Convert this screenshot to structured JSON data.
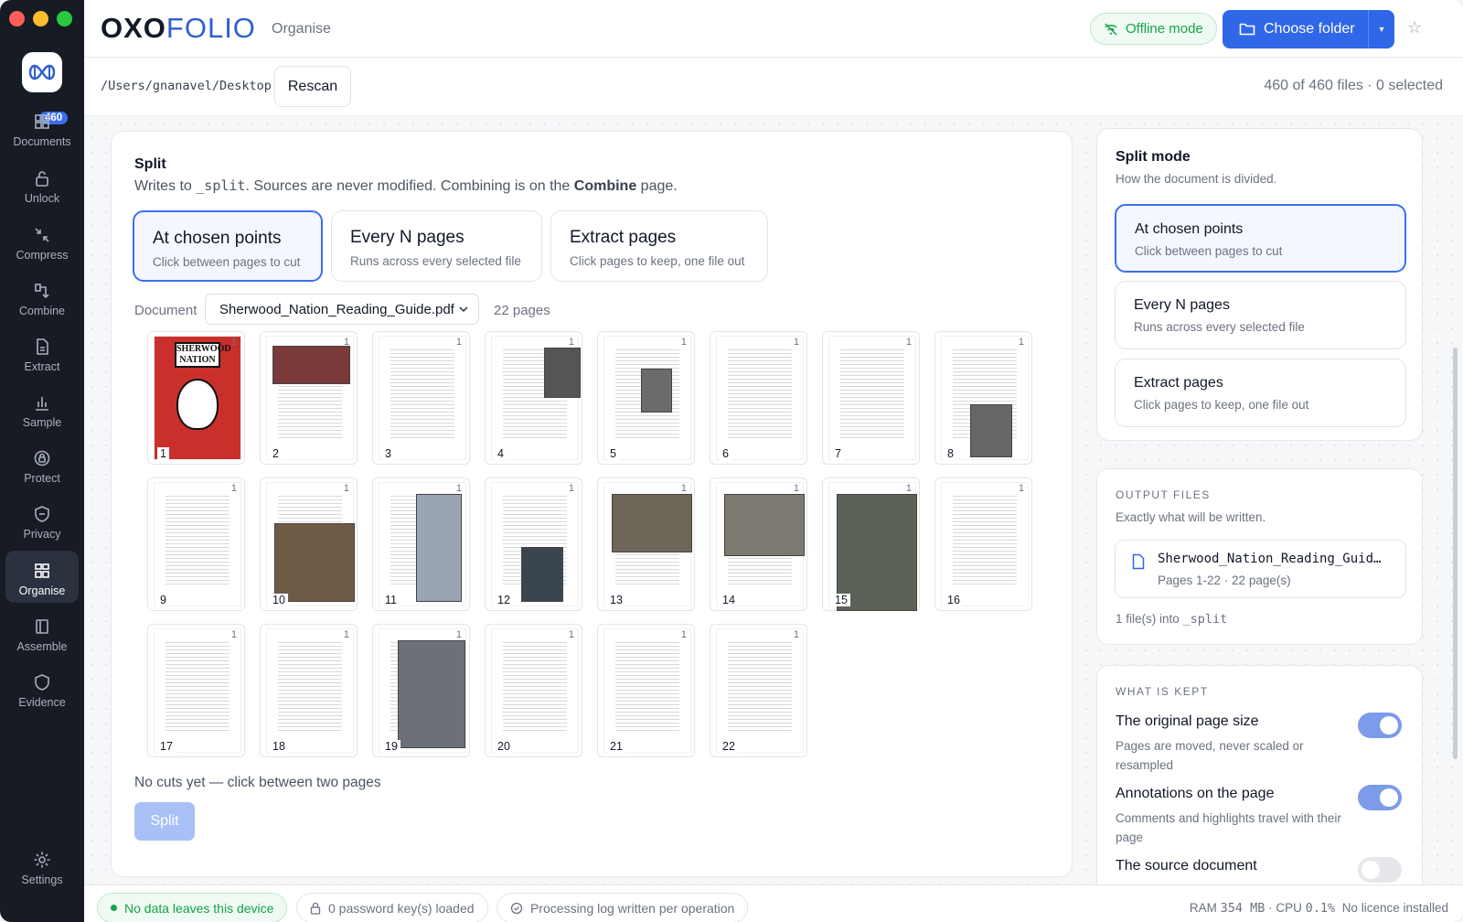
{
  "window": {
    "controls": [
      "close",
      "minimize",
      "maximize"
    ]
  },
  "brand": {
    "oxo": "OXO",
    "folio": "FOLIO",
    "section": "Organise"
  },
  "header": {
    "offline_label": "Offline mode",
    "choose_folder_label": "Choose folder",
    "caret": "▾",
    "star": "☆"
  },
  "sidebar": {
    "documents_badge": "460",
    "items": [
      {
        "label": "Documents",
        "icon": "grid-icon"
      },
      {
        "label": "Unlock",
        "icon": "unlock-icon"
      },
      {
        "label": "Compress",
        "icon": "compress-icon"
      },
      {
        "label": "Combine",
        "icon": "combine-icon"
      },
      {
        "label": "Extract",
        "icon": "extract-icon"
      },
      {
        "label": "Sample",
        "icon": "bar-chart-icon"
      },
      {
        "label": "Protect",
        "icon": "protect-icon"
      },
      {
        "label": "Privacy",
        "icon": "shield-icon"
      },
      {
        "label": "Organise",
        "icon": "organise-icon",
        "active": true
      },
      {
        "label": "Assemble",
        "icon": "assemble-icon"
      },
      {
        "label": "Evidence",
        "icon": "evidence-shield-icon"
      },
      {
        "label": "Settings",
        "icon": "gear-icon"
      }
    ]
  },
  "pathbar": {
    "path": "/Users/gnanavel/Desktop",
    "rescan_label": "Rescan",
    "file_count": "460 of 460 files · 0 selected"
  },
  "split": {
    "title": "Split",
    "desc_prefix": "Writes to ",
    "desc_code": "_split",
    "desc_mid": ". Sources are never modified. Combining is on the ",
    "desc_bold": "Combine",
    "desc_suffix": " page.",
    "modes": [
      {
        "title": "At chosen points",
        "desc": "Click between pages to cut",
        "selected": true
      },
      {
        "title": "Every N pages",
        "desc": "Runs across every selected file",
        "selected": false
      },
      {
        "title": "Extract pages",
        "desc": "Click pages to keep, one file out",
        "selected": false
      }
    ],
    "document_label": "Document",
    "document_value": "Sherwood_Nation_Reading_Guide.pdf",
    "pages_count": "22 pages",
    "page_corner_label": "1",
    "pages": [
      "1",
      "2",
      "3",
      "4",
      "5",
      "6",
      "7",
      "8",
      "9",
      "10",
      "11",
      "12",
      "13",
      "14",
      "15",
      "16",
      "17",
      "18",
      "19",
      "20",
      "21",
      "22"
    ],
    "cover_title": "SHERWOOD NATION",
    "status": "No cuts yet — click between two pages",
    "split_button": "Split"
  },
  "split_mode_panel": {
    "title": "Split mode",
    "subtitle": "How the document is divided.",
    "modes": [
      {
        "title": "At chosen points",
        "desc": "Click between pages to cut",
        "selected": true
      },
      {
        "title": "Every N pages",
        "desc": "Runs across every selected file",
        "selected": false
      },
      {
        "title": "Extract pages",
        "desc": "Click pages to keep, one file out",
        "selected": false
      }
    ]
  },
  "output_files": {
    "caption": "OUTPUT FILES",
    "subtitle": "Exactly what will be written.",
    "file_name": "Sherwood_Nation_Reading_Guid…",
    "file_detail": "Pages 1-22 · 22 page(s)",
    "summary_prefix": "1 file(s) into ",
    "summary_code": "_split"
  },
  "what_is_kept": {
    "caption": "WHAT IS KEPT",
    "items": [
      {
        "title": "The original page size",
        "desc": "Pages are moved, never scaled or resampled",
        "enabled": true
      },
      {
        "title": "Annotations on the page",
        "desc": "Comments and highlights travel with their page",
        "enabled": true
      },
      {
        "title": "The source document",
        "desc": "",
        "enabled": false
      }
    ]
  },
  "footer": {
    "no_data": "No data leaves this device",
    "password_keys": "0 password key(s) loaded",
    "processing_log": "Processing log written per operation",
    "ram_label": "RAM ",
    "ram_value": "354 MB",
    "cpu_label": "CPU ",
    "cpu_value": "0.1%",
    "licence": "No licence installed"
  },
  "colors": {
    "accent": "#2f67e8",
    "sidebar": "#171b24",
    "success": "#16a34a",
    "toggle_on": "#7c9be8"
  }
}
